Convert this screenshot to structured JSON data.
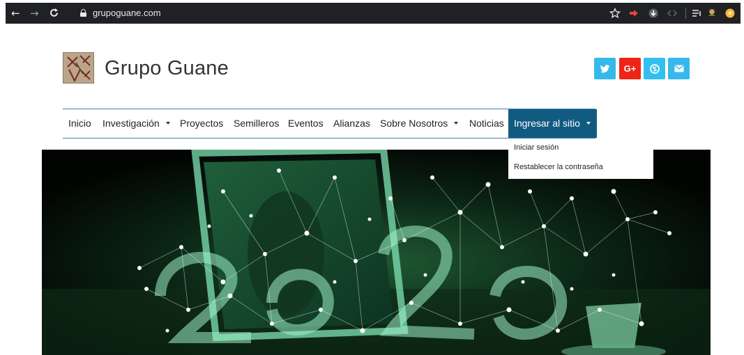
{
  "browser": {
    "url": "grupoguane.com",
    "back_icon": "arrow-left-icon",
    "forward_icon": "arrow-right-icon",
    "reload_icon": "reload-icon",
    "star_icon": "star-icon"
  },
  "site": {
    "title": "Grupo Guane"
  },
  "social": [
    {
      "name": "twitter",
      "icon": "twitter-icon",
      "color": "#36b9ea"
    },
    {
      "name": "google-plus",
      "icon": "google-plus-icon",
      "label": "G+",
      "color": "#ef2317"
    },
    {
      "name": "skype",
      "icon": "skype-icon",
      "color": "#31c0ef"
    },
    {
      "name": "email",
      "icon": "envelope-icon",
      "color": "#37b8ec"
    }
  ],
  "nav": {
    "items": [
      {
        "label": "Inicio"
      },
      {
        "label": "Investigación"
      },
      {
        "label": "Proyectos"
      },
      {
        "label": "Semilleros"
      },
      {
        "label": "Eventos"
      },
      {
        "label": "Alianzas"
      },
      {
        "label": "Sobre Nosotros"
      },
      {
        "label": "Noticias"
      },
      {
        "label": "Ingresar al sitio"
      }
    ],
    "active_color": "#115b80",
    "border_color": "#3f86a9"
  },
  "dropdown": {
    "items": [
      {
        "label": "Iniciar sesión"
      },
      {
        "label": "Restablecer la contraseña"
      }
    ]
  }
}
